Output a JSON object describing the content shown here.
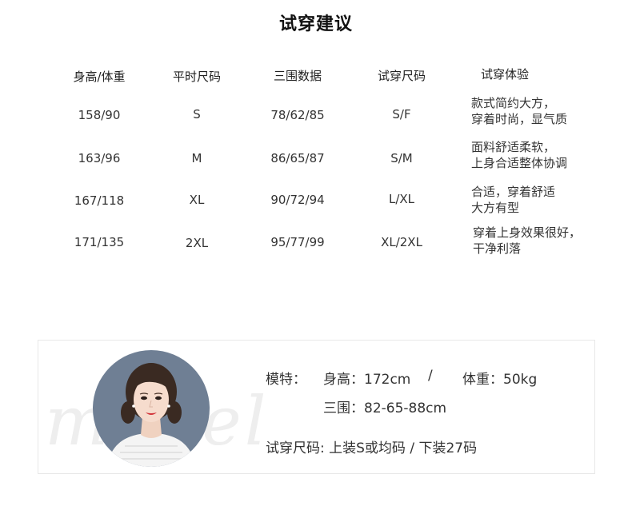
{
  "title": "试穿建议",
  "table": {
    "headers": [
      "身高/体重",
      "平时尺码",
      "三围数据",
      "试穿尺码",
      "试穿体验"
    ],
    "rows": [
      {
        "hw": "158/90",
        "size": "S",
        "measure": "78/62/85",
        "fit": "S/F",
        "exp": "款式简约大方，\n穿着时尚，显气质"
      },
      {
        "hw": "163/96",
        "size": "M",
        "measure": "86/65/87",
        "fit": "S/M",
        "exp": "面料舒适柔软，\n上身合适整体协调"
      },
      {
        "hw": "167/118",
        "size": "XL",
        "measure": "90/72/94",
        "fit": "L/XL",
        "exp": "合适，穿着舒适\n大方有型"
      },
      {
        "hw": "171/135",
        "size": "2XL",
        "measure": "95/77/99",
        "fit": "XL/2XL",
        "exp": "穿着上身效果很好，\n干净利落"
      }
    ]
  },
  "model": {
    "watermark": "model",
    "label": "模特：",
    "height": "身高：172cm",
    "separator": "/",
    "weight": "体重：50kg",
    "measurements": "三围：82-65-88cm",
    "fit_size": "试穿尺码: 上装S或均码 / 下装27码"
  },
  "colors": {
    "text": "#333333",
    "avatar_bg": "#6f7f94",
    "border": "#e8e8e8"
  }
}
